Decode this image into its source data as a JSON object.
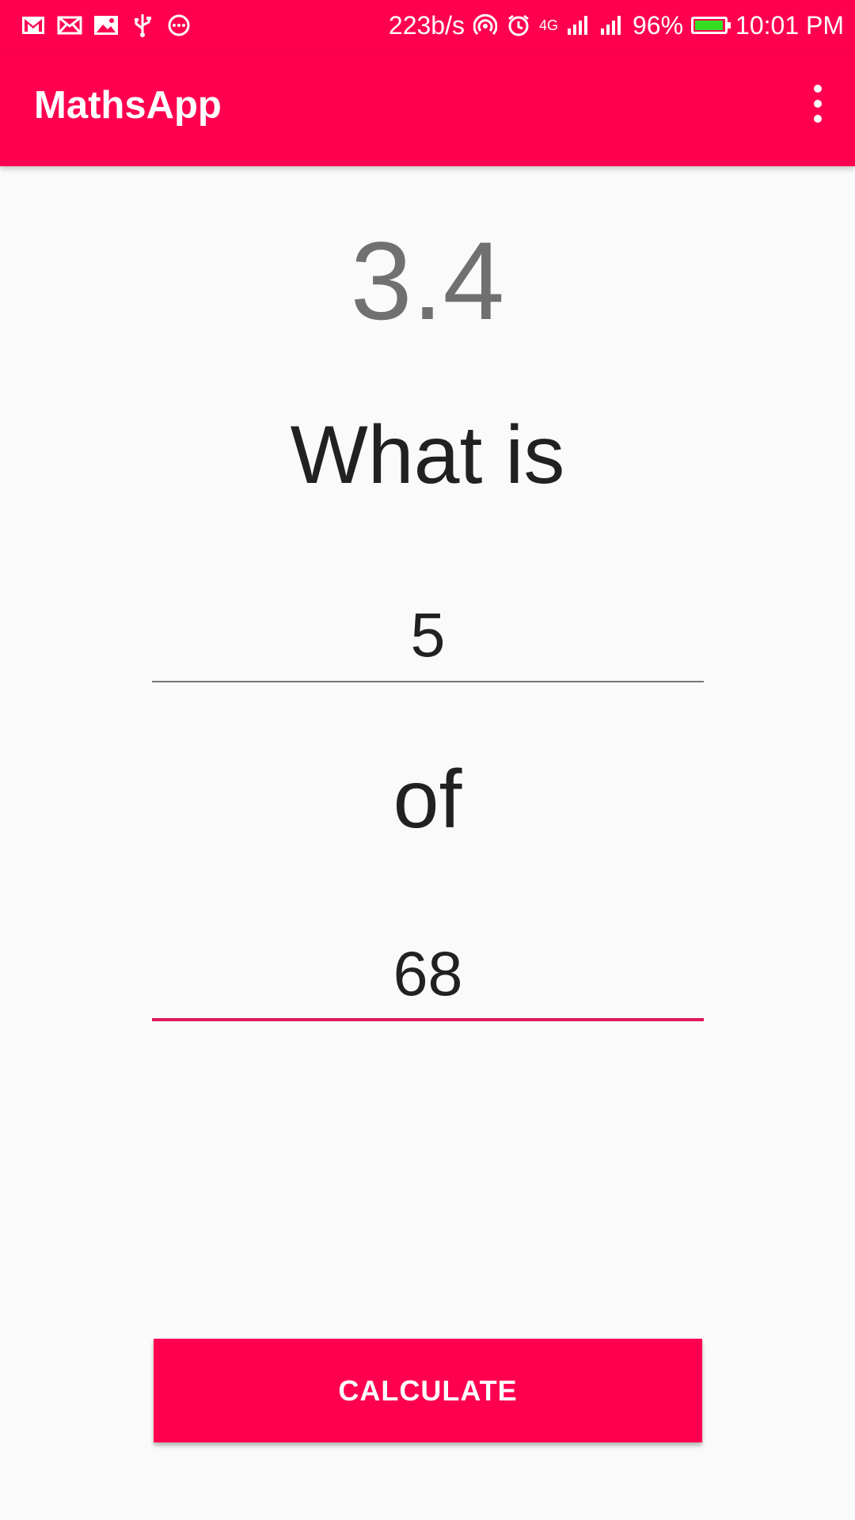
{
  "status_bar": {
    "left_icons": [
      "gmail-icon",
      "mail-icon",
      "image-icon",
      "usb-icon",
      "more-circle-icon"
    ],
    "net_speed": "223b/s",
    "network_type": "4G",
    "battery_percent": "96%",
    "battery_level": 0.96,
    "time": "10:01 PM"
  },
  "app_bar": {
    "title": "MathsApp",
    "menu_icon": "more-vert-icon"
  },
  "main": {
    "result": "3.4",
    "prompt_label": "What is",
    "percent_value": "5",
    "of_label": "of",
    "number_value": "68",
    "calculate_label": "CALCULATE"
  },
  "colors": {
    "primary": "#ff0050",
    "accent_underline": "#e0175c",
    "result_text": "#707070",
    "body_text": "#212121",
    "background": "#fafafa"
  }
}
